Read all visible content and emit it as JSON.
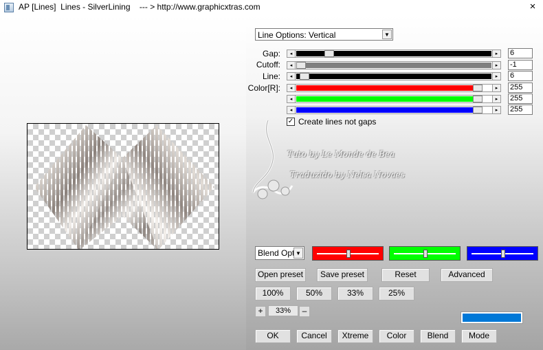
{
  "window": {
    "title": "AP [Lines]  Lines - SilverLining    --- > http://www.graphicxtras.com",
    "close_label": "×"
  },
  "line_options": {
    "selected": "Line Options: Vertical"
  },
  "sliders": [
    {
      "label": "Gap:",
      "value": "6",
      "fill_color": "#000000",
      "thumb_position": 0.15
    },
    {
      "label": "Cutoff:",
      "value": "-1",
      "fill_color": "#808080",
      "thumb_position": 0.0
    },
    {
      "label": "Line:",
      "value": "6",
      "fill_color": "#000000",
      "thumb_position": 0.02
    },
    {
      "label": "Color[R]:",
      "value": "255",
      "fill_color": "#ff0000",
      "thumb_position": 0.95
    },
    {
      "label": "",
      "value": "255",
      "fill_color": "#00ff00",
      "thumb_position": 0.95
    },
    {
      "label": "",
      "value": "255",
      "fill_color": "#0000ff",
      "thumb_position": 0.95
    }
  ],
  "checkbox": {
    "label": "Create lines not gaps",
    "checked": true
  },
  "watermark": {
    "line1": "Tuto by Le Monde de Bea",
    "line2": "Traduzido by Nelsa Novaes"
  },
  "blend": {
    "selected": "Blend Optic"
  },
  "color_boxes": [
    {
      "color": "#ff0000",
      "level": 0.5
    },
    {
      "color": "#00ff00",
      "level": 0.5
    },
    {
      "color": "#0000ff",
      "level": 0.5
    }
  ],
  "preset_buttons": [
    "Open preset",
    "Save preset",
    "Reset",
    "Advanced"
  ],
  "zoom_buttons": [
    "100%",
    "50%",
    "33%",
    "25%"
  ],
  "zoom": {
    "plus": "+",
    "value": "33%",
    "minus": "–"
  },
  "current_color": "#0078d7",
  "bottom_buttons": [
    "OK",
    "Cancel",
    "Xtreme",
    "Color",
    "Blend",
    "Mode"
  ]
}
